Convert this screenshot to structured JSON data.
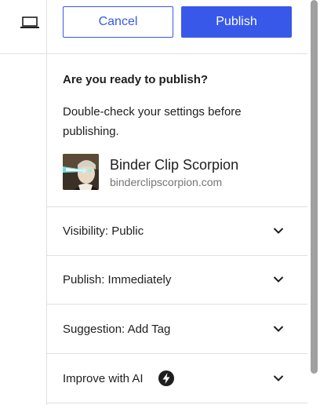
{
  "header": {
    "cancel_label": "Cancel",
    "publish_label": "Publish"
  },
  "prepublish": {
    "title": "Are you ready to publish?",
    "description": "Double-check your settings before publishing."
  },
  "site": {
    "name": "Binder Clip Scorpion",
    "url": "binderclipscorpion.com"
  },
  "panels": [
    {
      "label": "Visibility: Public",
      "icon": "chevron-down-icon"
    },
    {
      "label": "Publish: Immediately",
      "icon": "chevron-down-icon"
    },
    {
      "label": "Suggestion: Add Tag",
      "icon": "chevron-down-icon"
    },
    {
      "label": "Improve with AI",
      "icon": "chevron-down-icon",
      "badge_icon": "lightning-icon"
    }
  ],
  "colors": {
    "accent": "#3858e9",
    "text": "#1e1e1e",
    "muted": "#757575",
    "divider": "#e0e0e0"
  }
}
